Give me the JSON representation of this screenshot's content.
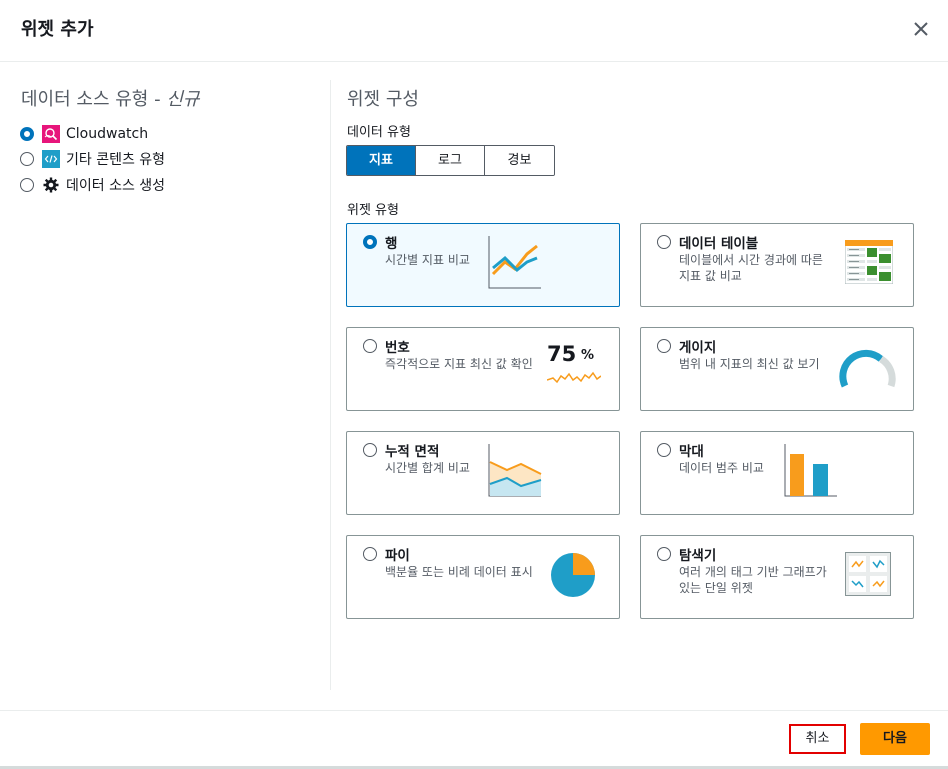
{
  "dialog": {
    "title": "위젯 추가",
    "close_icon": "close-icon"
  },
  "data_source": {
    "title": "데이터 소스 유형 - ",
    "title_new": "신규",
    "items": [
      {
        "label": "Cloudwatch",
        "icon": "cloudwatch-icon",
        "selected": true
      },
      {
        "label": "기타 콘텐츠 유형",
        "icon": "code-icon",
        "selected": false
      },
      {
        "label": "데이터 소스 생성",
        "icon": "gear-icon",
        "selected": false
      }
    ]
  },
  "config": {
    "title": "위젯 구성",
    "data_type_label": "데이터 유형",
    "data_type_options": [
      "지표",
      "로그",
      "경보"
    ],
    "data_type_selected": "지표",
    "widget_type_label": "위젯 유형",
    "widgets": [
      {
        "name": "행",
        "desc": "시간별 지표 비교",
        "selected": true
      },
      {
        "name": "데이터 테이블",
        "desc": "테이블에서 시간 경과에 따른 지표 값 비교",
        "selected": false
      },
      {
        "name": "번호",
        "desc": "즉각적으로 지표 최신 값 확인",
        "selected": false,
        "preview_value": "75",
        "preview_unit": "%"
      },
      {
        "name": "게이지",
        "desc": "범위 내 지표의 최신 값 보기",
        "selected": false
      },
      {
        "name": "누적 면적",
        "desc": "시간별 합계 비교",
        "selected": false
      },
      {
        "name": "막대",
        "desc": "데이터 범주 비교",
        "selected": false
      },
      {
        "name": "파이",
        "desc": "백분율 또는 비례 데이터 표시",
        "selected": false
      },
      {
        "name": "탐색기",
        "desc": "여러 개의 태그 기반 그래프가 있는 단일 위젯",
        "selected": false
      }
    ]
  },
  "footer": {
    "cancel_label": "취소",
    "next_label": "다음"
  },
  "colors": {
    "accent": "#0073bb",
    "primary_button": "#ff9900",
    "chart_orange": "#f89c1c",
    "chart_blue": "#1f9ec8",
    "highlight_border": "#e20000"
  }
}
